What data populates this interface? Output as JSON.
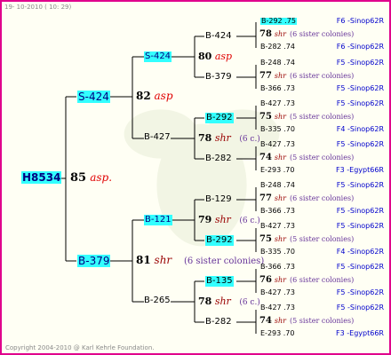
{
  "header": "19- 10-2010 ( 10: 29)",
  "footer": "Copyright 2004-2010 @ Karl Kehrle Foundation.",
  "root": {
    "id": "H8534",
    "num": "85",
    "race": "asp."
  },
  "g1": [
    {
      "id": "S-424",
      "num": "82",
      "race": "asp"
    },
    {
      "id": "B-379",
      "num": "81",
      "race": "shr",
      "note": "(6 sister colonies)"
    }
  ],
  "g2": [
    {
      "id": "S-424",
      "num": "80",
      "race": "asp"
    },
    {
      "id": "B-427",
      "num": "78",
      "race": "shr",
      "note": "(6 c.)"
    },
    {
      "id": "B-121",
      "num": "79",
      "race": "shr",
      "note": "(6 c.)"
    },
    {
      "id": "B-265",
      "num": "78",
      "race": "shr",
      "note": "(6 c.)"
    }
  ],
  "g3": [
    "B-424",
    "B-379",
    "B-292",
    "B-282",
    "B-129",
    "B-292",
    "B-135",
    "B-282"
  ],
  "g4": [
    {
      "top": "B-292 .75",
      "num": "78",
      "race": "shr",
      "note": "(6 sister colonies)",
      "bot": "B-282 .74"
    },
    {
      "top": "B-248 .74",
      "num": "77",
      "race": "shr",
      "note": "(6 sister colonies)",
      "bot": "B-366 .73"
    },
    {
      "top": "B-427 .73",
      "num": "75",
      "race": "shr",
      "note": "(5 sister colonies)",
      "bot": "B-335 .70"
    },
    {
      "top": "B-427 .73",
      "num": "74",
      "race": "shr",
      "note": "(5 sister colonies)",
      "bot": "E-293 .70"
    },
    {
      "top": "B-248 .74",
      "num": "77",
      "race": "shr",
      "note": "(6 sister colonies)",
      "bot": "B-366 .73"
    },
    {
      "top": "B-427 .73",
      "num": "75",
      "race": "shr",
      "note": "(5 sister colonies)",
      "bot": "B-335 .70"
    },
    {
      "top": "B-366 .73",
      "num": "76",
      "race": "shr",
      "note": "(6 sister colonies)",
      "bot": "B-427 .73"
    },
    {
      "top": "B-427 .73",
      "num": "74",
      "race": "shr",
      "note": "(5 sister colonies)",
      "bot": "E-293 .70"
    }
  ],
  "locations": [
    "F6 -Sinop62R",
    "F6 -Sinop62R",
    "F5 -Sinop62R",
    "F5 -Sinop62R",
    "F5 -Sinop62R",
    "F4 -Sinop62R",
    "F5 -Sinop62R",
    "F3 -Egypt66R",
    "F5 -Sinop62R",
    "F5 -Sinop62R",
    "F5 -Sinop62R",
    "F4 -Sinop62R",
    "F5 -Sinop62R",
    "F5 -Sinop62R",
    "F5 -Sinop62R",
    "F3 -Egypt66R"
  ],
  "colors": {
    "border": "#e0008c",
    "highlight": "#33ffff",
    "race": "#cc0000",
    "location": "#0000cc"
  }
}
